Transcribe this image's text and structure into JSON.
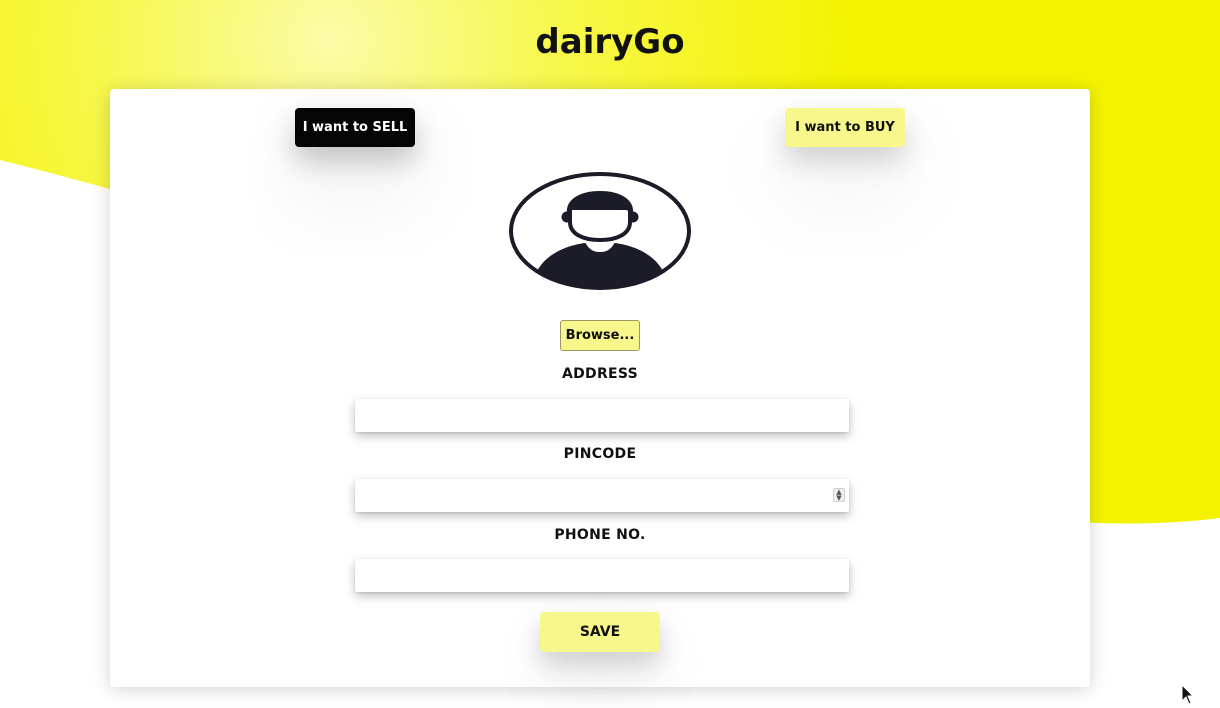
{
  "app": {
    "title": "dairyGo"
  },
  "roles": {
    "sell_label": "I want to SELL",
    "buy_label": "I want to BUY"
  },
  "profile": {
    "avatar_icon": "user-avatar-icon",
    "browse_label": "Browse..."
  },
  "form": {
    "address_label": "ADDRESS",
    "address_value": "",
    "pincode_label": "PINCODE",
    "pincode_value": "",
    "phone_label": "PHONE NO.",
    "phone_value": "",
    "save_label": "SAVE"
  },
  "colors": {
    "accent_yellow": "#f7f78c",
    "background_yellow": "#f5f500",
    "sell_button": "#050505",
    "text": "#111111"
  }
}
